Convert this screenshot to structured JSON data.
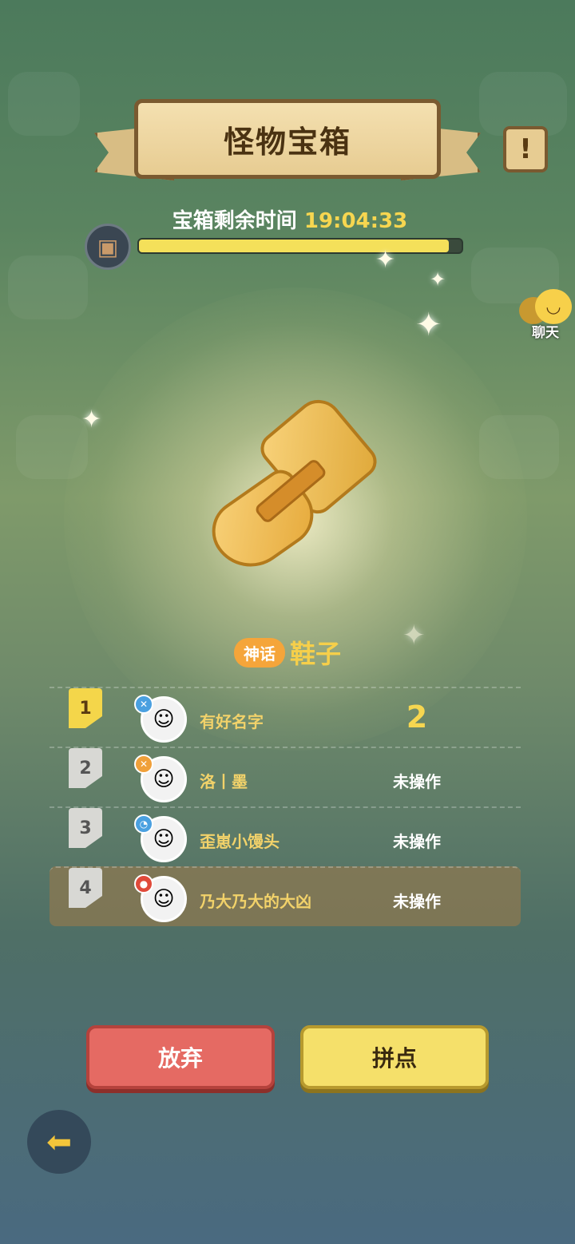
{
  "header": {
    "title": "怪物宝箱",
    "info_icon": "!"
  },
  "timer": {
    "label": "宝箱剩余时间",
    "value": "19:04:33",
    "progress": 0.96
  },
  "chat": {
    "label": "聊天"
  },
  "item": {
    "rarity": "神话",
    "name": "鞋子"
  },
  "players": [
    {
      "rank": "1",
      "name": "有好名字",
      "status": "2",
      "role_color": "#4aa0e0",
      "avatar_icon": "blue-haired-character"
    },
    {
      "rank": "2",
      "name": "洛丨墨",
      "status": "未操作",
      "role_color": "#f0a03a",
      "avatar_icon": "headband-character"
    },
    {
      "rank": "3",
      "name": "歪崽小馒头",
      "status": "未操作",
      "role_color": "#4aa0e0",
      "avatar_icon": "blue-haired-character"
    },
    {
      "rank": "4",
      "name": "乃大乃大的大凶",
      "status": "未操作",
      "role_color": "#e04a3a",
      "avatar_icon": "red-haired-character"
    }
  ],
  "actions": {
    "give_up": "放弃",
    "roll": "拼点"
  },
  "colors": {
    "gold": "#f6d650",
    "accent_red": "#e56a63",
    "accent_yellow": "#f5e06a"
  }
}
